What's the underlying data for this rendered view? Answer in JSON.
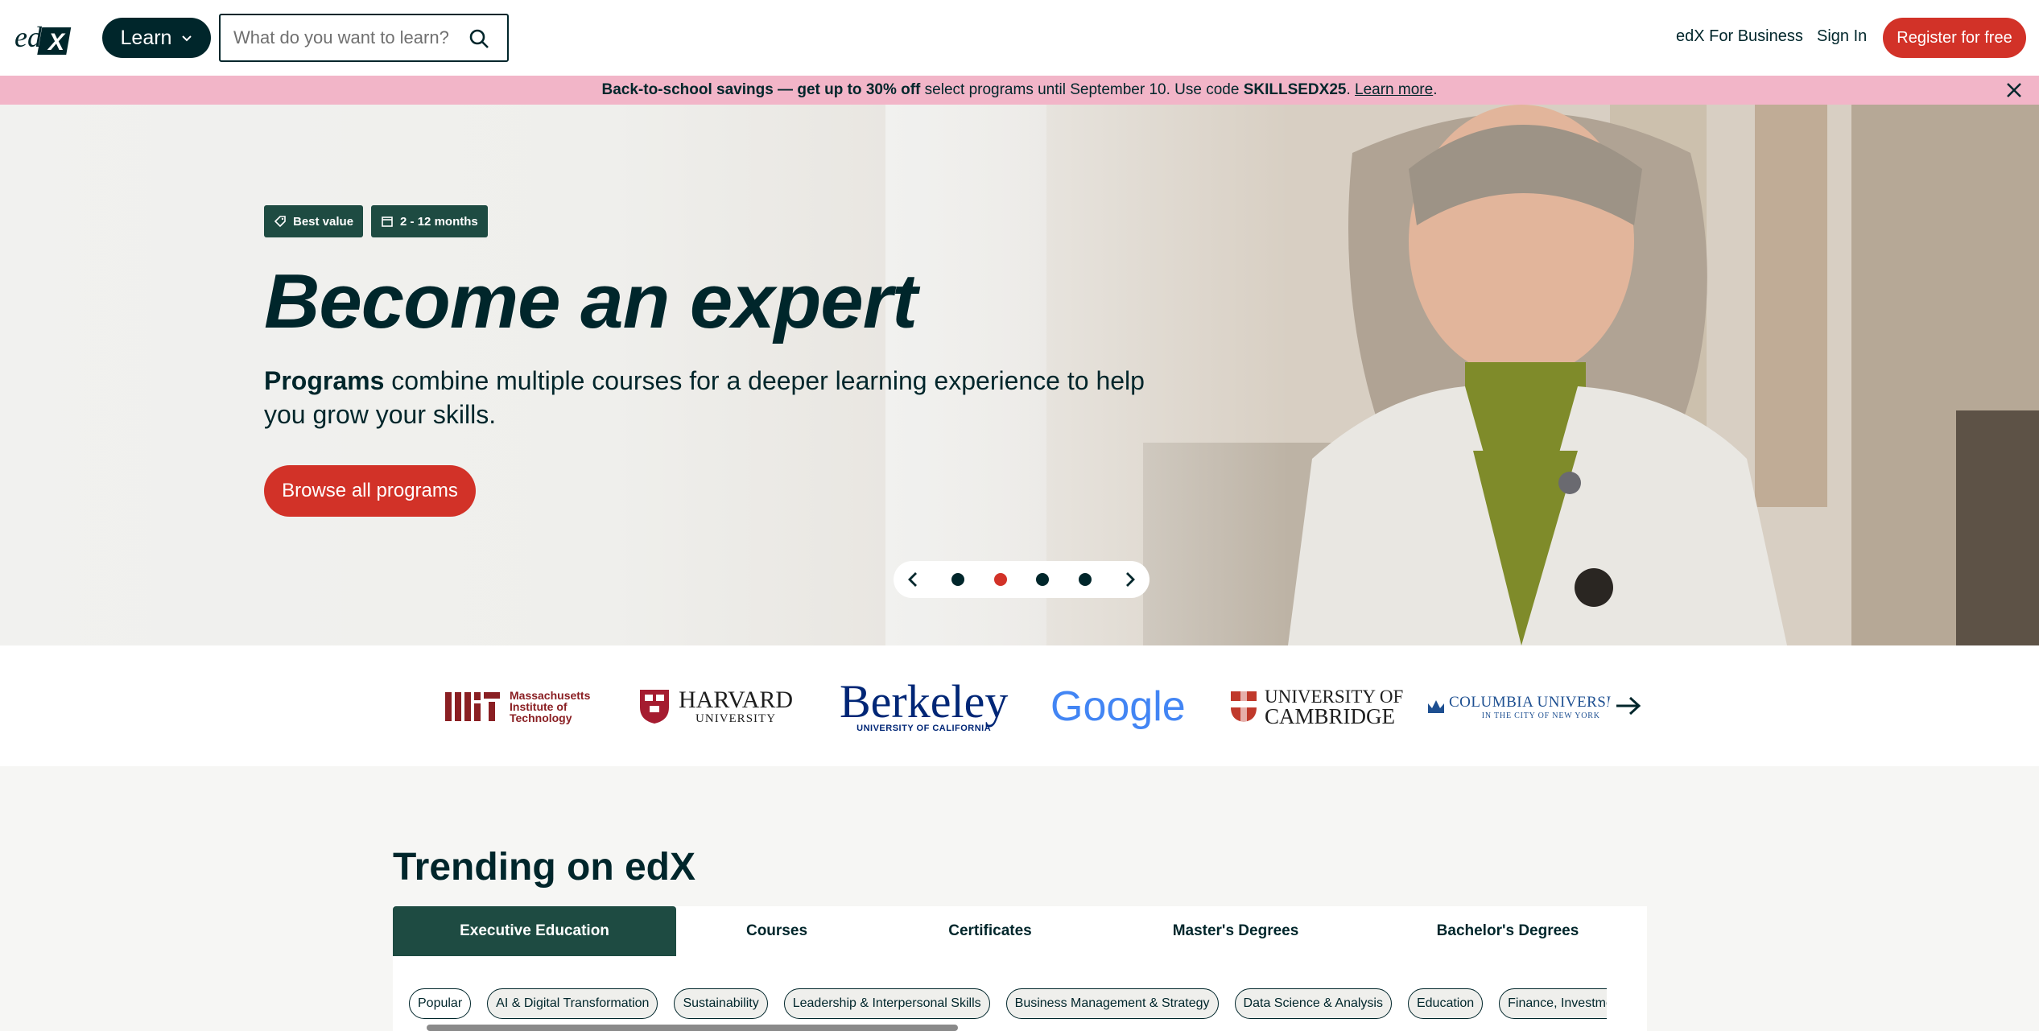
{
  "header": {
    "learn_label": "Learn",
    "search_placeholder": "What do you want to learn?",
    "for_business": "edX For Business",
    "sign_in": "Sign In",
    "register": "Register for free"
  },
  "promo": {
    "bold_text": "Back-to-school savings — get up to 30% off",
    "text": " select programs until September 10. Use code ",
    "code": "SKILLSEDX25",
    "period": ".",
    "link": "Learn more"
  },
  "hero": {
    "badges": [
      "Best value",
      "2 - 12 months"
    ],
    "title": "Become an expert",
    "desc_bold": "Programs",
    "desc": " combine multiple courses for a deeper learning experience to help you grow your skills.",
    "cta": "Browse all programs",
    "active_slide": 2
  },
  "logos": {
    "mit": {
      "l1": "Massachusetts",
      "l2": "Institute of",
      "l3": "Technology"
    },
    "harvard": {
      "l1": "HARVARD",
      "l2": "UNIVERSITY"
    },
    "berkeley": {
      "l1": "Berkeley",
      "l2": "UNIVERSITY OF CALIFORNIA"
    },
    "google": "Google",
    "cambridge": {
      "l1": "UNIVERSITY OF",
      "l2": "CAMBRIDGE"
    },
    "columbia": {
      "l1": "COLUMBIA UNIVERSITY",
      "l2": "IN THE CITY OF NEW YORK"
    }
  },
  "trending": {
    "title": "Trending on edX",
    "tabs": [
      "Executive Education",
      "Courses",
      "Certificates",
      "Master's Degrees",
      "Bachelor's Degrees"
    ],
    "chips": [
      "Popular",
      "AI & Digital Transformation",
      "Sustainability",
      "Leadership & Interpersonal Skills",
      "Business Management & Strategy",
      "Data Science & Analysis",
      "Education",
      "Finance, Investment & F"
    ]
  },
  "colors": {
    "brand_dark": "#00262b",
    "accent_red": "#d23228",
    "promo_pink": "#f2b5c8",
    "badge_green": "#1e4b42"
  }
}
